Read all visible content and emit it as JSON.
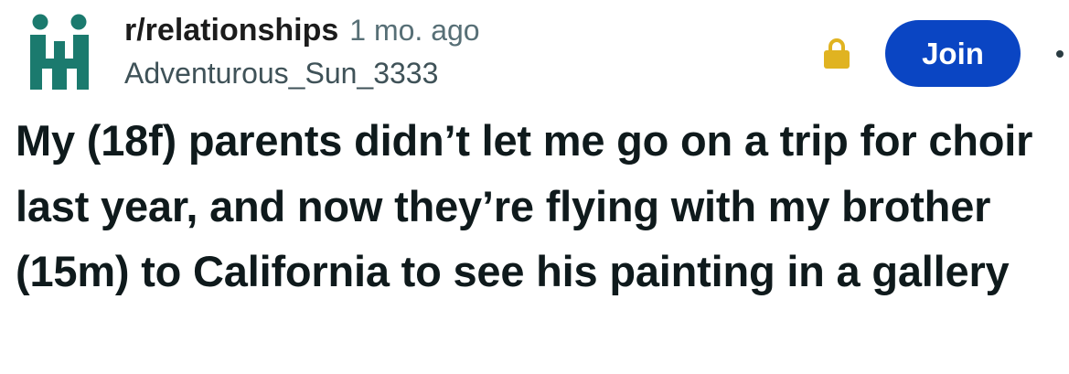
{
  "header": {
    "subreddit_icon": "subreddit-people-icon",
    "subreddit": "r/relationships",
    "time_ago": "1 mo. ago",
    "username": "Adventurous_Sun_3333",
    "lock_icon": "lock-icon",
    "join_label": "Join",
    "overflow_icon": "overflow-menu-icon"
  },
  "post": {
    "title": "My (18f) parents didn’t let me go on a trip for choir last year, and now they’re flying with my brother (15m) to California to see his painting in a gallery"
  },
  "colors": {
    "subreddit_icon": "#1b7a6e",
    "join_button": "#0a45c3",
    "lock": "#e0b321",
    "meta_text": "#576f76"
  }
}
